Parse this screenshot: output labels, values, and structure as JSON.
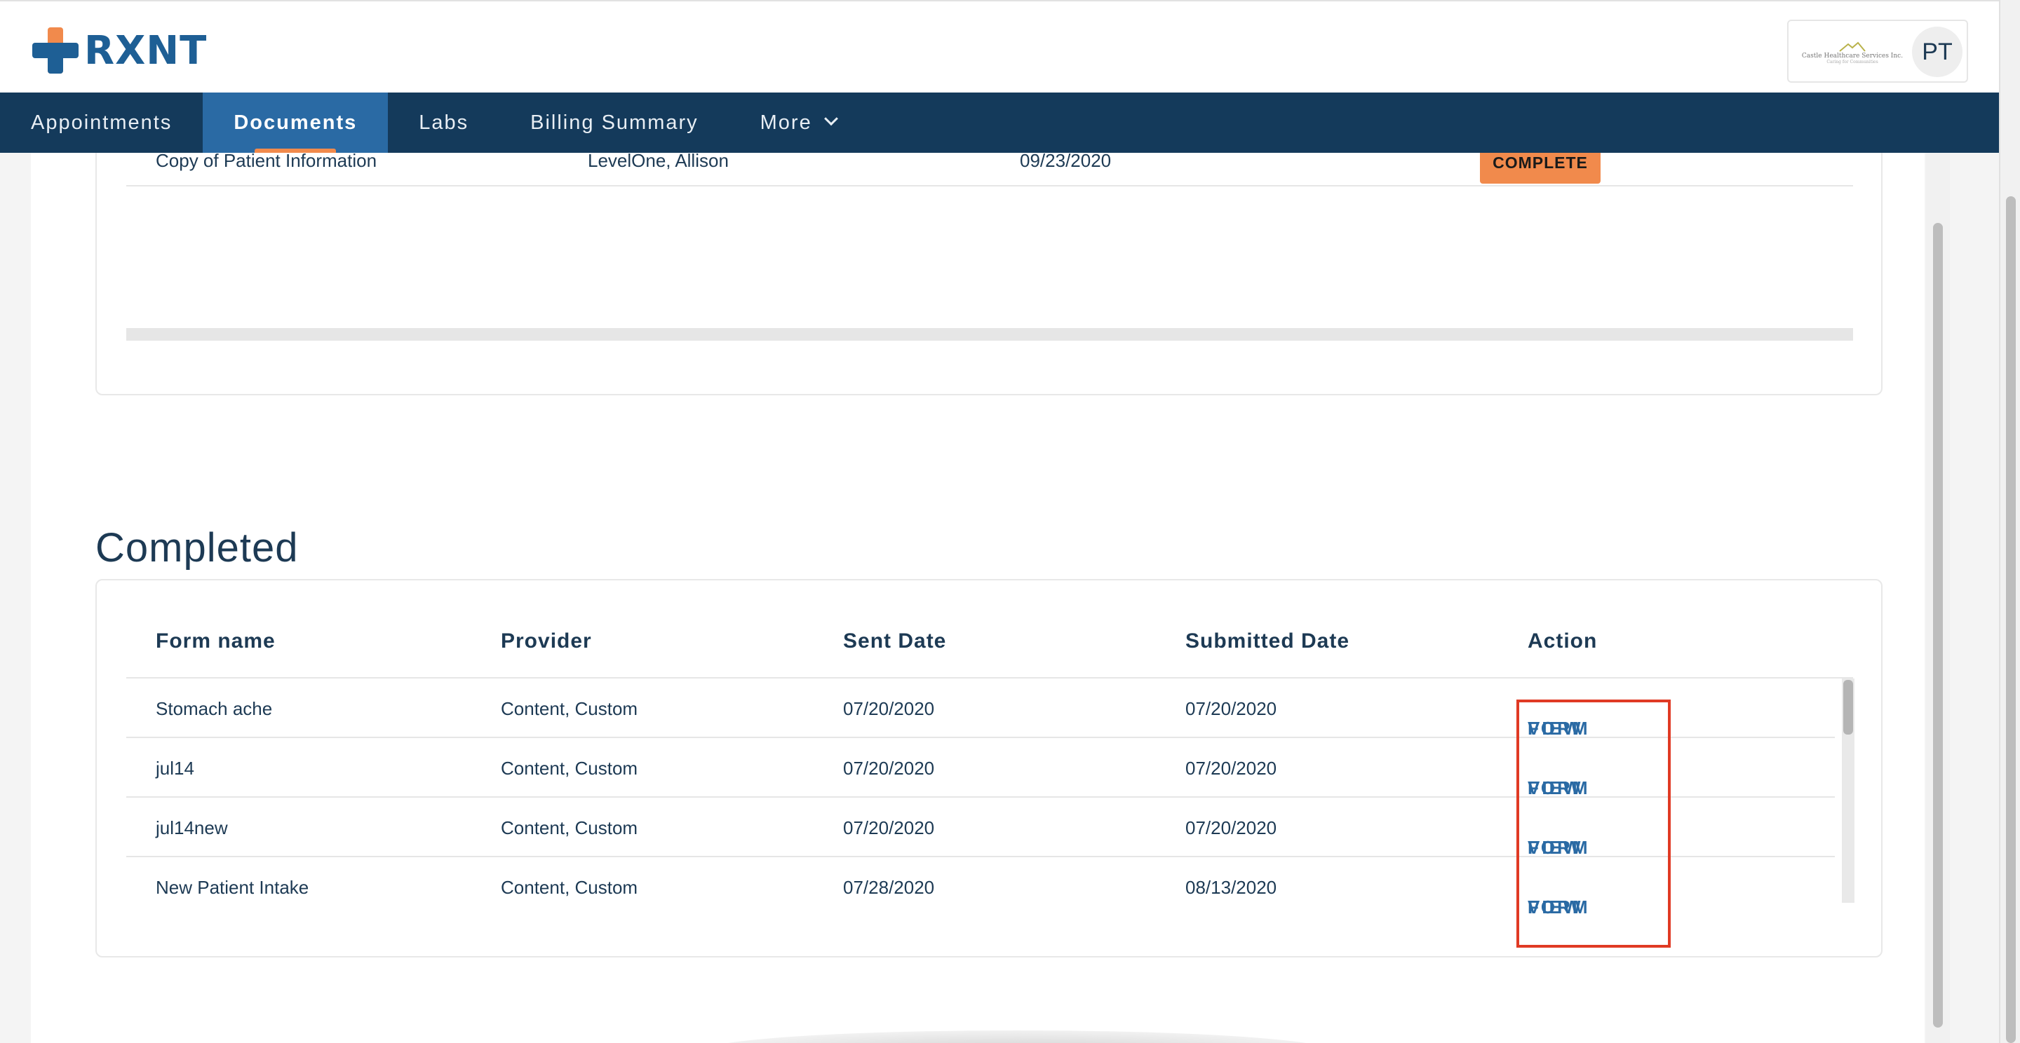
{
  "brand": {
    "name": "RXNT"
  },
  "profile": {
    "clinic_name": "Castle Healthcare Services Inc.",
    "clinic_tagline": "Caring for Communities",
    "avatar_initials": "PT"
  },
  "nav": {
    "items": [
      {
        "label": "Appointments"
      },
      {
        "label": "Documents"
      },
      {
        "label": "Labs"
      },
      {
        "label": "Billing Summary"
      },
      {
        "label": "More"
      }
    ]
  },
  "pending": {
    "row": {
      "form_name": "Copy of Patient Information",
      "provider": "LevelOne, Allison",
      "sent_date": "09/23/2020",
      "status": "COMPLETE"
    }
  },
  "completed": {
    "title": "Completed",
    "columns": [
      "Form name",
      "Provider",
      "Sent Date",
      "Submitted Date",
      "Action"
    ],
    "action_label_1": "VIEW",
    "action_label_2": "FORM",
    "rows": [
      {
        "form_name": "Stomach ache",
        "provider": "Content, Custom",
        "sent_date": "07/20/2020",
        "submitted_date": "07/20/2020"
      },
      {
        "form_name": "jul14",
        "provider": "Content, Custom",
        "sent_date": "07/20/2020",
        "submitted_date": "07/20/2020"
      },
      {
        "form_name": "jul14new",
        "provider": "Content, Custom",
        "sent_date": "07/20/2020",
        "submitted_date": "07/20/2020"
      },
      {
        "form_name": "New Patient Intake",
        "provider": "Content, Custom",
        "sent_date": "07/28/2020",
        "submitted_date": "08/13/2020"
      }
    ]
  },
  "colors": {
    "nav_bg": "#143a5b",
    "nav_active": "#2a6aa4",
    "accent_orange": "#f18a4c",
    "brand_blue": "#1e5f95",
    "highlight_red": "#e03a24"
  }
}
